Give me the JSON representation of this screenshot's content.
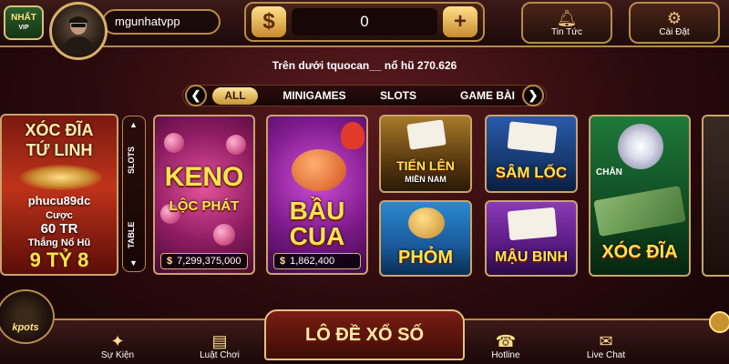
{
  "logo": {
    "text": "NHẤT",
    "sub": "VIP"
  },
  "user": {
    "username": "mgunhatvpp"
  },
  "balance": {
    "currency_symbol": "$",
    "value": "0",
    "add_symbol": "+"
  },
  "top_buttons": {
    "news": "Tin Tức",
    "settings": "Cài Đặt"
  },
  "marquee": "Trên dưới tquocan__ nổ hũ 270.626",
  "categories": {
    "tabs": [
      "ALL",
      "MINIGAMES",
      "SLOTS",
      "GAME BÀI"
    ],
    "active": "ALL",
    "prev_symbol": "❮",
    "next_symbol": "❯"
  },
  "promo_card": {
    "title1": "XÓC ĐĨA",
    "title2": "TỨ LINH",
    "player": "phucu89dc",
    "bet_label": "Cược",
    "bet_value": "60 TR",
    "win_label": "Thắng Nổ Hũ",
    "win_value": "9 TỶ 8"
  },
  "side_tabs": [
    "SLOTS",
    "TABLE"
  ],
  "games": [
    {
      "name1": "KENO",
      "name2": "LỘC PHÁT",
      "jackpot": "7,299,375,000"
    },
    {
      "name1": "BẦU",
      "name2": "CUA",
      "jackpot": "1,862,400"
    },
    {
      "name1": "TIẾN LÊN",
      "name2": "MIỀN NAM"
    },
    {
      "name1": "SÂM LỐC"
    },
    {
      "name1": "PHỎM"
    },
    {
      "name1": "MẬU BINH"
    },
    {
      "name1": "XÓC ĐĨA",
      "label": "CHẴN"
    }
  ],
  "bottom_nav": {
    "events": "Sự Kiện",
    "rules": "Luật Chơi",
    "center": "LÔ ĐỀ XỔ SỐ",
    "hotline": "Hotline",
    "live_chat": "Live Chat"
  },
  "jackpots_badge": "kpots",
  "colors": {
    "gold": "#ffe34d",
    "border_gold": "#b98a4a",
    "bg_dark": "#2a0a0c"
  }
}
